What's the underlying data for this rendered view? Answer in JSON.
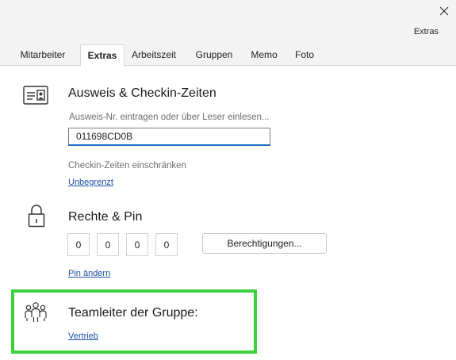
{
  "window": {
    "title": "Extras"
  },
  "tabs": [
    {
      "label": "Mitarbeiter"
    },
    {
      "label": "Extras"
    },
    {
      "label": "Arbeitszeit"
    },
    {
      "label": "Gruppen"
    },
    {
      "label": "Memo"
    },
    {
      "label": "Foto"
    }
  ],
  "active_tab": "Extras",
  "ausweis": {
    "title": "Ausweis & Checkin-Zeiten",
    "input_hint": "Ausweis-Nr. eintragen oder über Leser einlesen...",
    "input_value": "011698CD0B",
    "checkin_label": "Checkin-Zeiten einschränken",
    "checkin_link": "Unbegrenzt"
  },
  "rechte": {
    "title": "Rechte & Pin",
    "pin_digits": [
      "0",
      "0",
      "0",
      "0"
    ],
    "permissions_button": "Berechtigungen...",
    "pin_change_link": "Pin ändern"
  },
  "teamleiter": {
    "title": "Teamleiter der Gruppe:",
    "group_link": "Vertrieb"
  },
  "colors": {
    "highlight": "#3ed13e",
    "link": "#1b4fa8",
    "input_focus": "#1b6ec2"
  }
}
